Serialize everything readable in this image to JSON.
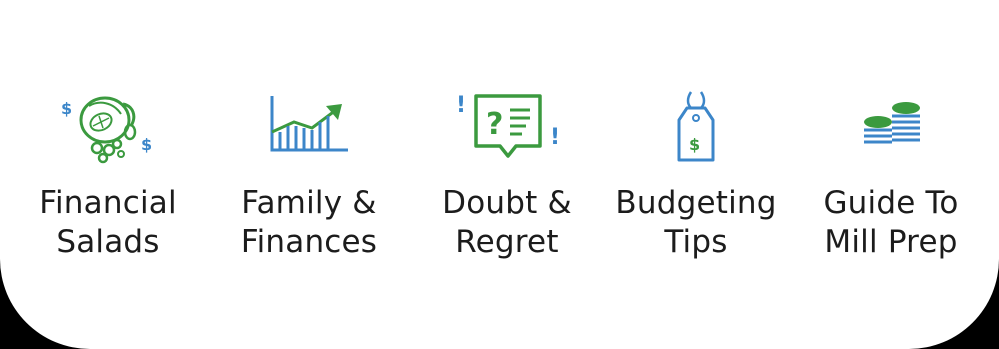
{
  "colors": {
    "green": "#3b9a3f",
    "blue": "#3c86c9",
    "text": "#1c1c1c",
    "background": "#ffffff"
  },
  "categories": [
    {
      "icon": "salad-money-icon",
      "line1": "Financial",
      "line2": "Salads"
    },
    {
      "icon": "growth-chart-icon",
      "line1": "Family &",
      "line2": "Finances"
    },
    {
      "icon": "question-message-icon",
      "line1": "Doubt &",
      "line2": "Regret"
    },
    {
      "icon": "price-tag-icon",
      "line1": "Budgeting",
      "line2": "Tips"
    },
    {
      "icon": "coin-stacks-icon",
      "line1": "Guide To",
      "line2": "Mill Prep"
    }
  ],
  "icon_glyphs": {
    "dollar": "$",
    "exclamation": "!",
    "question": "?"
  }
}
